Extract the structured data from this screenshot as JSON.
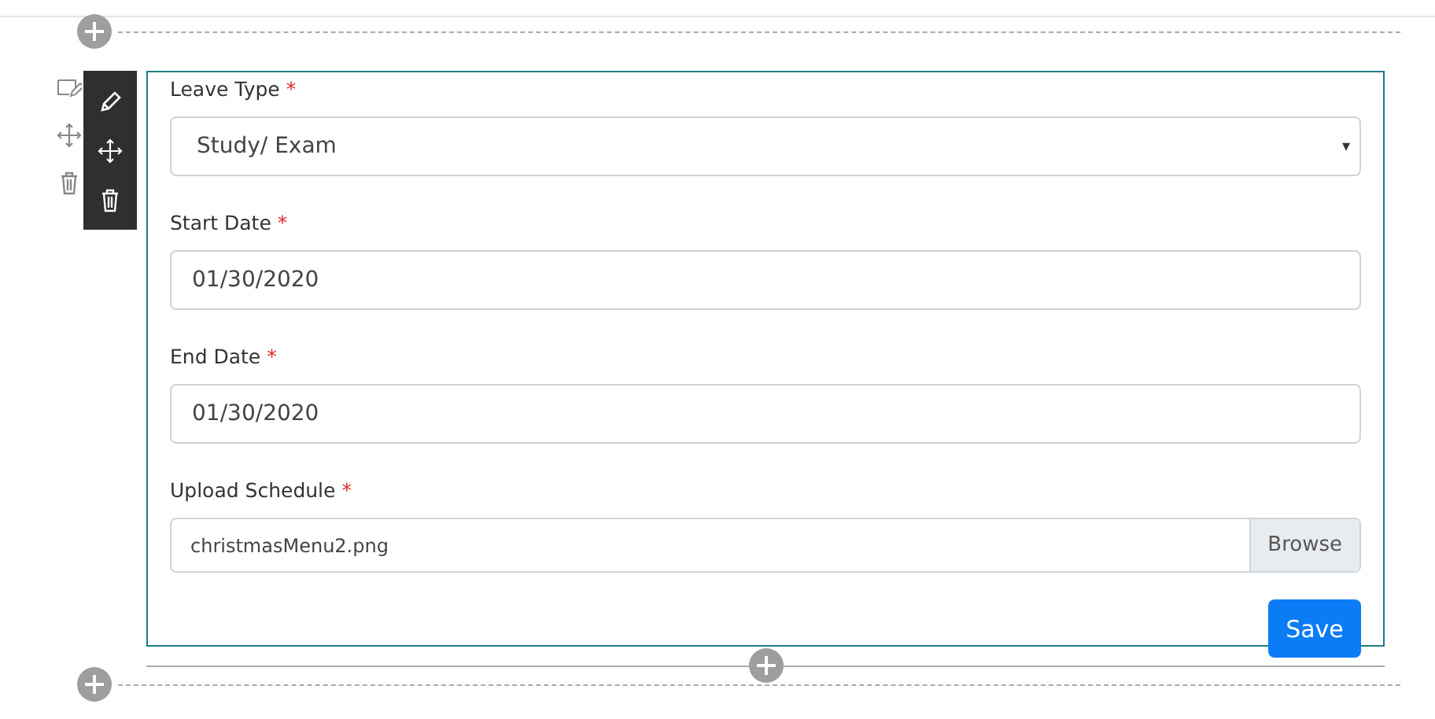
{
  "fields": [
    {
      "kind": "select",
      "label": "Leave Type",
      "required_mark": "*",
      "value": "Study/ Exam",
      "caret": "▾"
    },
    {
      "kind": "date",
      "label": "Start Date",
      "required_mark": "*",
      "value": "01/30/2020"
    },
    {
      "kind": "date",
      "label": "End Date",
      "required_mark": "*",
      "value": "01/30/2020"
    },
    {
      "kind": "file",
      "label": "Upload Schedule",
      "required_mark": "*",
      "value": "christmasMenu2.png",
      "button": "Browse"
    }
  ],
  "save_button": "Save"
}
